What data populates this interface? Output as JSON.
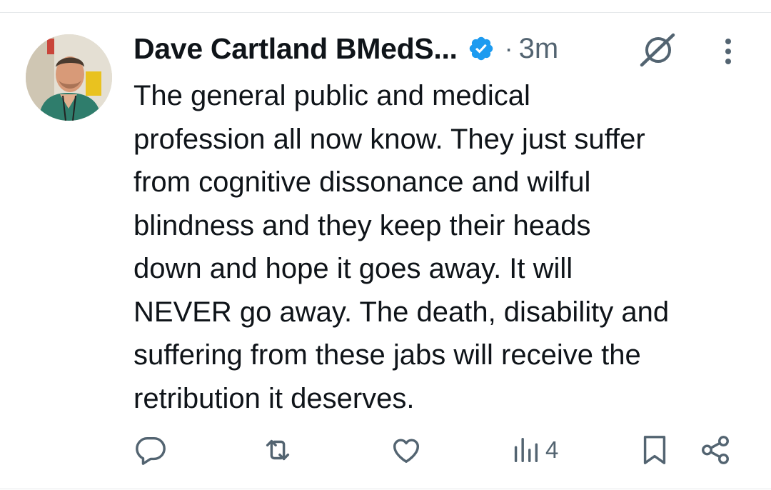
{
  "tweet": {
    "author": {
      "name": "Dave Cartland BMedS...",
      "verified": true,
      "avatar": "profile photo of a man in green scrubs"
    },
    "separator": "·",
    "time": "3m",
    "text": "The general public and medical\nprofession all now know. They just suffer\nfrom cognitive dissonance and wilful\nblindness and they keep their heads\ndown and hope it goes away. It will\nNEVER go away. The death, disability and\nsuffering from these jabs will receive the\nretribution it deserves.",
    "actions": {
      "views_count": "4"
    }
  },
  "icons": {
    "verified": "verified-badge-icon",
    "grok": "grok-icon",
    "more": "more-vertical-icon",
    "reply": "reply-icon",
    "retweet": "retweet-icon",
    "like": "like-icon",
    "views": "views-icon",
    "bookmark": "bookmark-icon",
    "share": "share-icon"
  },
  "colors": {
    "text": "#0f1419",
    "secondary": "#536471",
    "verified": "#1d9bf0",
    "divider": "#e6e9eb"
  }
}
